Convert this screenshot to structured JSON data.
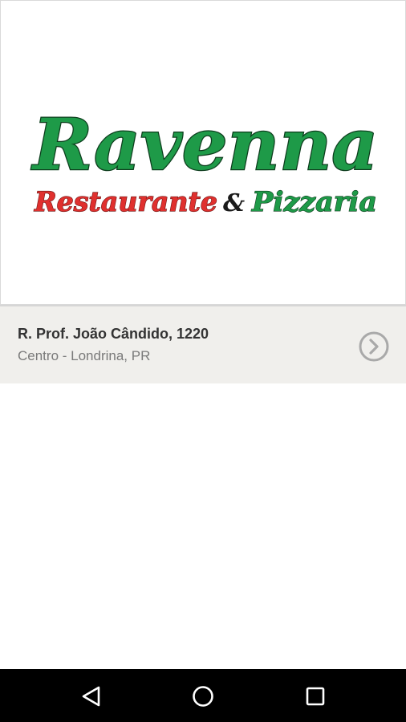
{
  "logo": {
    "title": "Ravenna",
    "subtitle_part1": "Restaurante",
    "ampersand": "&",
    "subtitle_part2": "Pizzaria",
    "colors": {
      "green": "#1e9a48",
      "red": "#e0302e",
      "dark": "#1a1a1a"
    }
  },
  "address": {
    "street": "R. Prof. João Cândido, 1220",
    "city": "Centro - Londrina, PR",
    "action_icon": "chevron-right-circle-icon"
  },
  "navbar": {
    "back_icon": "back-triangle-icon",
    "home_icon": "home-circle-icon",
    "recents_icon": "recents-square-icon"
  }
}
